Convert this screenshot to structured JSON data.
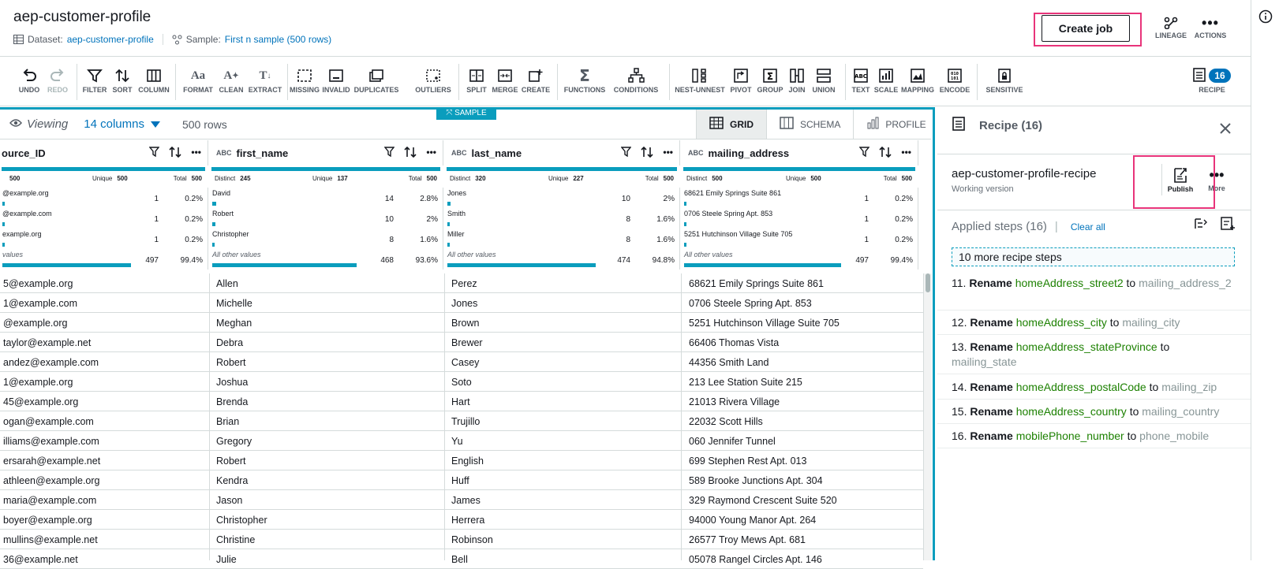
{
  "header": {
    "title": "aep-customer-profile",
    "dataset_label": "Dataset:",
    "dataset_value": "aep-customer-profile",
    "sample_label": "Sample:",
    "sample_value": "First n sample (500 rows)",
    "create_job": "Create job",
    "lineage": "LINEAGE",
    "actions": "ACTIONS"
  },
  "toolbar": {
    "undo": "UNDO",
    "redo": "REDO",
    "filter": "FILTER",
    "sort": "SORT",
    "column": "COLUMN",
    "format": "FORMAT",
    "clean": "CLEAN",
    "extract": "EXTRACT",
    "missing": "MISSING",
    "invalid": "INVALID",
    "duplicates": "DUPLICATES",
    "outliers": "OUTLIERS",
    "split": "SPLIT",
    "merge": "MERGE",
    "create": "CREATE",
    "functions": "FUNCTIONS",
    "conditions": "CONDITIONS",
    "nest_unnest": "NEST-UNNEST",
    "pivot": "PIVOT",
    "group": "GROUP",
    "join": "JOIN",
    "union": "UNION",
    "text": "TEXT",
    "scale": "SCALE",
    "mapping": "MAPPING",
    "encode": "ENCODE",
    "sensitive": "SENSITIVE",
    "recipe": "RECIPE",
    "recipe_count": "16"
  },
  "grid": {
    "sample_tag": "SAMPLE",
    "viewing": "Viewing",
    "columns": "14 columns",
    "rows": "500 rows",
    "tab_grid": "GRID",
    "tab_schema": "SCHEMA",
    "tab_profile": "PROFILE",
    "type_abc": "ABC",
    "columns_meta": [
      {
        "name": "ource_ID",
        "stats": {
          "distinct_label": "",
          "distinct": "500",
          "unique_label": "Unique",
          "unique": "500",
          "total_label": "Total",
          "total": "500"
        },
        "values": [
          {
            "v": "@example.org",
            "c": "1",
            "p": "0.2%",
            "frac": 0.002
          },
          {
            "v": "@example.com",
            "c": "1",
            "p": "0.2%",
            "frac": 0.002
          },
          {
            "v": "example.org",
            "c": "1",
            "p": "0.2%",
            "frac": 0.002
          },
          {
            "v": "values",
            "c": "497",
            "p": "99.4%",
            "frac": 0.994
          }
        ]
      },
      {
        "name": "first_name",
        "stats": {
          "distinct_label": "Distinct",
          "distinct": "245",
          "unique_label": "Unique",
          "unique": "137",
          "total_label": "Total",
          "total": "500"
        },
        "values": [
          {
            "v": "David",
            "c": "14",
            "p": "2.8%",
            "frac": 0.028
          },
          {
            "v": "Robert",
            "c": "10",
            "p": "2%",
            "frac": 0.02
          },
          {
            "v": "Christopher",
            "c": "8",
            "p": "1.6%",
            "frac": 0.016
          },
          {
            "v": "All other values",
            "c": "468",
            "p": "93.6%",
            "frac": 0.936
          }
        ]
      },
      {
        "name": "last_name",
        "stats": {
          "distinct_label": "Distinct",
          "distinct": "320",
          "unique_label": "Unique",
          "unique": "227",
          "total_label": "Total",
          "total": "500"
        },
        "values": [
          {
            "v": "Jones",
            "c": "10",
            "p": "2%",
            "frac": 0.02
          },
          {
            "v": "Smith",
            "c": "8",
            "p": "1.6%",
            "frac": 0.016
          },
          {
            "v": "Miller",
            "c": "8",
            "p": "1.6%",
            "frac": 0.016
          },
          {
            "v": "All other values",
            "c": "474",
            "p": "94.8%",
            "frac": 0.948
          }
        ]
      },
      {
        "name": "mailing_address",
        "stats": {
          "distinct_label": "Distinct",
          "distinct": "500",
          "unique_label": "Unique",
          "unique": "500",
          "total_label": "Total",
          "total": "500"
        },
        "values": [
          {
            "v": "68621 Emily Springs Suite 861",
            "c": "1",
            "p": "0.2%",
            "frac": 0.002
          },
          {
            "v": "0706 Steele Spring Apt. 853",
            "c": "1",
            "p": "0.2%",
            "frac": 0.002
          },
          {
            "v": "5251 Hutchinson Village Suite 705",
            "c": "1",
            "p": "0.2%",
            "frac": 0.002
          },
          {
            "v": "All other values",
            "c": "497",
            "p": "99.4%",
            "frac": 0.994
          }
        ]
      }
    ],
    "rows_data": [
      [
        "5@example.org",
        "Allen",
        "Perez",
        "68621 Emily Springs Suite 861"
      ],
      [
        "1@example.com",
        "Michelle",
        "Jones",
        "0706 Steele Spring Apt. 853"
      ],
      [
        "@example.org",
        "Meghan",
        "Brown",
        "5251 Hutchinson Village Suite 705"
      ],
      [
        "taylor@example.net",
        "Debra",
        "Brewer",
        "66406 Thomas Vista"
      ],
      [
        "andez@example.com",
        "Robert",
        "Casey",
        "44356 Smith Land"
      ],
      [
        "1@example.org",
        "Joshua",
        "Soto",
        "213 Lee Station Suite 215"
      ],
      [
        "45@example.org",
        "Brenda",
        "Hart",
        "21013 Rivera Village"
      ],
      [
        "ogan@example.com",
        "Brian",
        "Trujillo",
        "22032 Scott Hills"
      ],
      [
        "illiams@example.com",
        "Gregory",
        "Yu",
        "060 Jennifer Tunnel"
      ],
      [
        "ersarah@example.net",
        "Robert",
        "English",
        "699 Stephen Rest Apt. 013"
      ],
      [
        "athleen@example.org",
        "Kendra",
        "Huff",
        "589 Brooke Junctions Apt. 304"
      ],
      [
        "maria@example.com",
        "Jason",
        "James",
        "329 Raymond Crescent Suite 520"
      ],
      [
        "boyer@example.org",
        "Christopher",
        "Herrera",
        "94000 Young Manor Apt. 264"
      ],
      [
        "mullins@example.net",
        "Christine",
        "Robinson",
        "26577 Troy Mews Apt. 681"
      ],
      [
        "36@example.net",
        "Julie",
        "Bell",
        "05078 Rangel Circles Apt. 146"
      ]
    ]
  },
  "recipe": {
    "title": "Recipe (16)",
    "name": "aep-customer-profile-recipe",
    "version": "Working version",
    "publish": "Publish",
    "more": "More",
    "applied_steps": "Applied steps (16)",
    "clear_all": "Clear all",
    "more_steps": "10 more recipe steps",
    "steps": [
      {
        "num": "11.",
        "action": "Rename",
        "from": "homeAddress_street2",
        "to_word": "to",
        "to": "mailing_address_2"
      },
      {
        "num": "12.",
        "action": "Rename",
        "from": "homeAddress_city",
        "to_word": "to",
        "to": "mailing_city"
      },
      {
        "num": "13.",
        "action": "Rename",
        "from": "homeAddress_stateProvince",
        "to_word": "to",
        "to": "mailing_state"
      },
      {
        "num": "14.",
        "action": "Rename",
        "from": "homeAddress_postalCode",
        "to_word": "to",
        "to": "mailing_zip"
      },
      {
        "num": "15.",
        "action": "Rename",
        "from": "homeAddress_country",
        "to_word": "to",
        "to": "mailing_country"
      },
      {
        "num": "16.",
        "action": "Rename",
        "from": "mobilePhone_number",
        "to_word": "to",
        "to": "phone_mobile"
      }
    ]
  },
  "colors": {
    "accent": "#0a9dbd",
    "link": "#0073bb",
    "highlight": "#e8347a",
    "step_source": "#1d8102",
    "step_target": "#879596"
  }
}
